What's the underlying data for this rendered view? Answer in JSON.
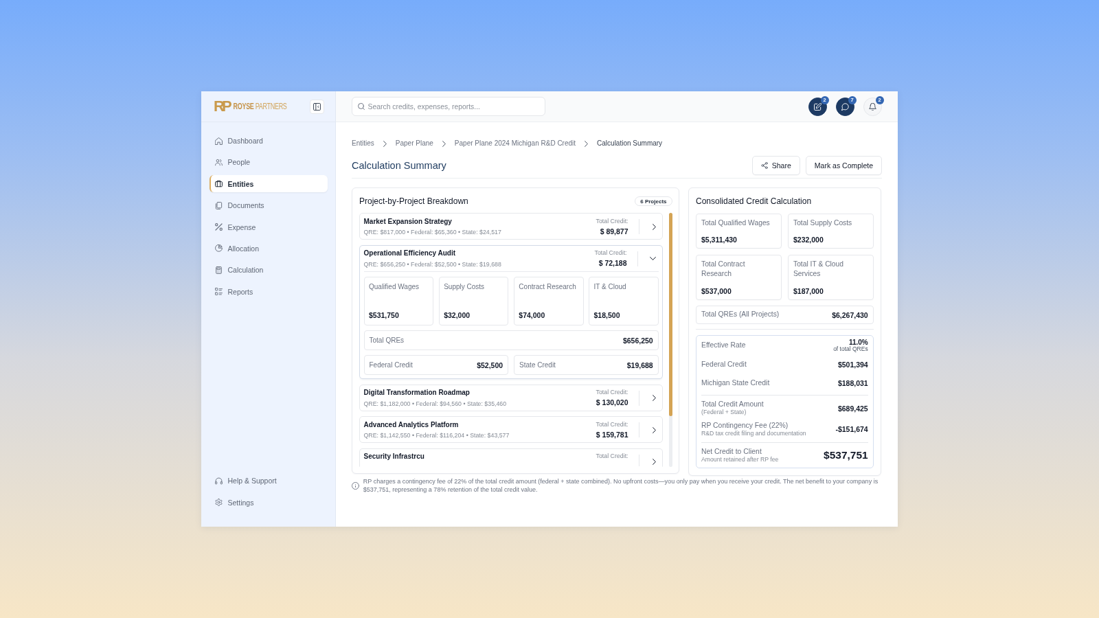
{
  "sidebar": {
    "brand": {
      "mark": "RP",
      "name": "ROYSE",
      "name_suffix": "PARTNERS"
    },
    "items": [
      {
        "label": "Dashboard",
        "selected": false
      },
      {
        "label": "People",
        "selected": false
      },
      {
        "label": "Entities",
        "selected": true
      },
      {
        "label": "Documents",
        "selected": false
      },
      {
        "label": "Expense",
        "selected": false
      },
      {
        "label": "Allocation",
        "selected": false
      },
      {
        "label": "Calculation",
        "selected": false
      },
      {
        "label": "Reports",
        "selected": false
      }
    ],
    "footer_items": [
      {
        "label": "Help & Support",
        "selected": false
      },
      {
        "label": "Settings",
        "selected": false
      }
    ]
  },
  "top_bar": {
    "search": {
      "placeholder": "Search credits, expenses, reports..."
    },
    "buttons": [
      {
        "count": "2",
        "highlighted": true
      },
      {
        "count": "7",
        "highlighted": true
      },
      {
        "count": "2",
        "highlighted": false
      }
    ]
  },
  "breadcrumbs": [
    {
      "label": "Entities",
      "current": false
    },
    {
      "label": "Paper Plane",
      "current": false
    },
    {
      "label": "Paper Plane 2024 Michigan R&D Credit",
      "current": false
    },
    {
      "label": "Calculation Summary",
      "current": true
    }
  ],
  "page": {
    "title": "Calculation Summary",
    "actions": [
      {
        "kind": "share",
        "label": "Share"
      },
      {
        "kind": "plain",
        "label": "Mark as Complete"
      }
    ]
  },
  "projects": {
    "title": "Project-by-Project Breakdown",
    "count": "6 Projects",
    "items": [
      {
        "name": "Market Expansion Strategy",
        "details": "QRE: $817,000 • Federal: $65,360 • State: $24,517",
        "total_label": "Total Credit:",
        "total": "$ 89,877",
        "expanded": false
      },
      {
        "name": "Operational Efficiency Audit",
        "details": "QRE: $656,250 • Federal: $52,500 • State: $19,688",
        "total_label": "Total Credit:",
        "total": "$ 72,188",
        "expanded": true,
        "breakdown": {
          "categories": [
            {
              "label": "Qualified Wages",
              "value": "$531,750"
            },
            {
              "label": "Supply Costs",
              "value": "$32,000"
            },
            {
              "label": "Contract Research",
              "value": "$74,000"
            },
            {
              "label": "IT & Cloud",
              "value": "$18,500"
            }
          ],
          "total": {
            "label": "Total QREs",
            "value": "$656,250"
          },
          "credits": [
            {
              "label": "Federal Credit",
              "value": "$52,500"
            },
            {
              "label": "State Credit",
              "value": "$19,688"
            }
          ]
        }
      },
      {
        "name": "Digital Transformation Roadmap",
        "details": "QRE: $1,182,000 • Federal: $94,560 • State: $35,460",
        "total_label": "Total Credit:",
        "total": "$ 130,020",
        "expanded": false
      },
      {
        "name": "Advanced Analytics Platform",
        "details": "QRE: $1,142,550 • Federal: $116,204 • State: $43,577",
        "total_label": "Total Credit:",
        "total": "$ 159,781",
        "expanded": false
      },
      {
        "name": "Security Infrastrcu",
        "total_label": "Total Credit:",
        "expanded": false
      }
    ]
  },
  "consolidated": {
    "title": "Consolidated Credit Calculation",
    "tiles": [
      {
        "label": "Total Qualified Wages",
        "value": "$5,311,430"
      },
      {
        "label": "Total Supply Costs",
        "value": "$232,000"
      },
      {
        "label": "Total Contract Research",
        "value": "$537,000"
      },
      {
        "label": "Total IT & Cloud Services",
        "value": "$187,000"
      }
    ],
    "total": {
      "label": "Total QREs (All Projects)",
      "value": "$6,267,430"
    },
    "summary_groups": [
      {
        "rows": [
          {
            "kind": "rate",
            "label": "Effective Rate",
            "value": "11.0%",
            "note": "of total QREs"
          },
          {
            "kind": "amount",
            "label": "Federal Credit",
            "value": "$501,394"
          },
          {
            "kind": "amount",
            "label": "Michigan State Credit",
            "value": "$188,031"
          }
        ]
      },
      {
        "rows": [
          {
            "kind": "amount",
            "label": "Total Credit Amount",
            "sublabel": "(Federal + State)",
            "value": "$689,425"
          },
          {
            "kind": "amount",
            "label": "RP Contingency Fee (22%)",
            "sublabel": "R&D tax credit filing and documentation",
            "value": "-$151,674"
          }
        ]
      },
      {
        "rows": [
          {
            "kind": "net",
            "label": "Net Credit to Client",
            "sublabel": "Amount retained after RP fee",
            "value": "$537,751"
          }
        ]
      }
    ]
  },
  "note": "RP charges a contingency fee of 22% of the total credit amount (federal + state combined). No upfront costs—you only pay when you receive your credit. The net benefit to your company is $537,751, representing a 78% retention of the total credit value."
}
